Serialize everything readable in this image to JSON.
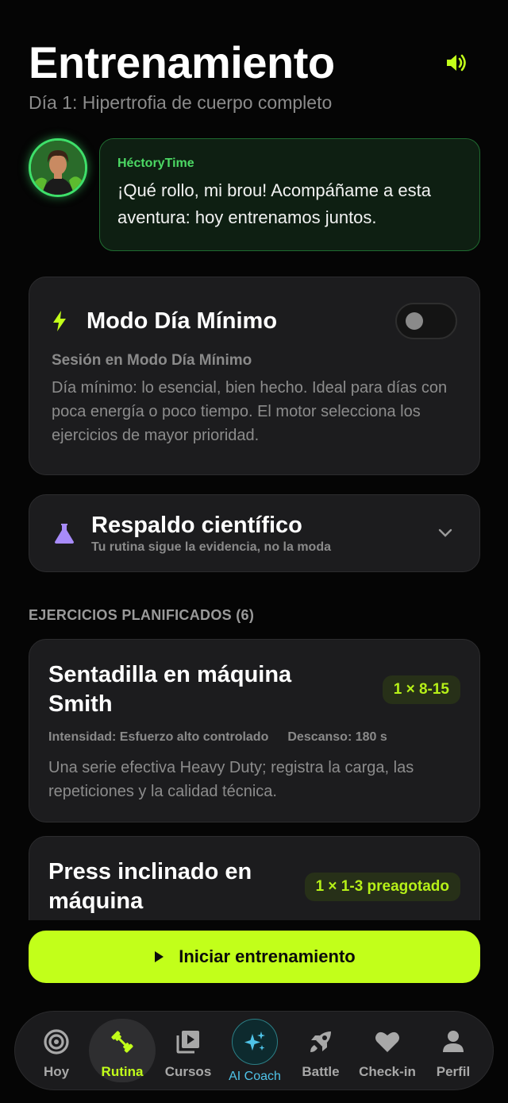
{
  "header": {
    "title": "Entrenamiento",
    "subtitle": "Día 1: Hipertrofia de cuerpo completo",
    "sound_icon": "speaker-volume-icon"
  },
  "coach_message": {
    "name": "HéctoryTime",
    "text": "¡Qué rollo, mi brou! Acompáñame a esta aventura: hoy entrenamos juntos."
  },
  "minimum_mode": {
    "title": "Modo Día Mínimo",
    "enabled": false,
    "subheading": "Sesión en Modo Día Mínimo",
    "description": "Día mínimo: lo esencial, bien hecho. Ideal para días con poca energía o poco tiempo. El motor selecciona los ejercicios de mayor prioridad."
  },
  "science": {
    "title": "Respaldo científico",
    "subtitle": "Tu rutina sigue la evidencia, no la moda"
  },
  "exercises": {
    "section_label": "EJERCICIOS PLANIFICADOS (6)",
    "items": [
      {
        "name": "Sentadilla en máquina Smith",
        "badge": "1 × 8-15",
        "intensity": "Intensidad: Esfuerzo alto controlado",
        "rest": "Descanso: 180 s",
        "description": "Una serie efectiva Heavy Duty; registra la carga, las repeticiones y la calidad técnica."
      },
      {
        "name": "Press inclinado en máquina",
        "badge": "1 × 1-3 preagotado"
      }
    ]
  },
  "start_button": {
    "label": "Iniciar entrenamiento"
  },
  "tabbar": {
    "items": [
      {
        "label": "Hoy",
        "icon": "target-icon"
      },
      {
        "label": "Rutina",
        "icon": "dumbbell-icon",
        "active": true
      },
      {
        "label": "Cursos",
        "icon": "video-library-icon"
      },
      {
        "label": "AI Coach",
        "icon": "sparkles-icon"
      },
      {
        "label": "Battle",
        "icon": "rocket-icon"
      },
      {
        "label": "Check-in",
        "icon": "heart-icon"
      },
      {
        "label": "Perfil",
        "icon": "person-icon"
      }
    ]
  },
  "colors": {
    "accent": "#c2ff1a",
    "coach_green": "#4cd964",
    "science_purple": "#a78bfa",
    "ai_coach_blue": "#4fc3e8",
    "background": "#050505",
    "card": "#1c1c1e"
  }
}
